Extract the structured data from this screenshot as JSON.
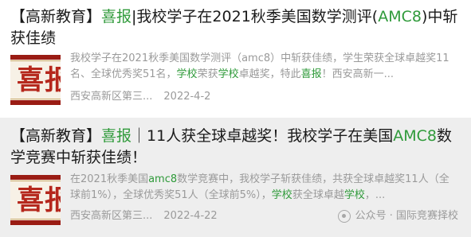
{
  "articles": [
    {
      "title_prefix": "【高新教育】",
      "title_highlight": "喜报",
      "title_rest_a": "|我校学子在2021秋季美国数学测评(",
      "title_highlight2": "AMC8",
      "title_rest_b": ")中斩获佳绩",
      "thumb_text": "喜报",
      "desc_a": "我校学子在2021秋季美国数学测评（amc8）中斩获佳绩，学生荣获全球卓越奖11名、全球优秀奖51名，",
      "desc_hl1": "学校",
      "desc_b": "荣获",
      "desc_hl2": "学校",
      "desc_c": "卓越奖，特此",
      "desc_hl3": "喜报",
      "desc_d": "！西安高新一...",
      "source": "西安高新区第三...",
      "date": "2022-4-2"
    },
    {
      "title_prefix": "【高新教育】",
      "title_highlight": "喜报",
      "title_rest_a": "｜11人获全球卓越奖！我校学子在美国",
      "title_highlight2": "AMC8",
      "title_rest_b": "数学竞赛中斩获佳绩！",
      "thumb_text": "喜报",
      "desc_a": "在2021秋季美国",
      "desc_hl1": "amc8",
      "desc_b": "数学竞赛中，我校学子斩获佳绩，共获全球卓越奖11人（全球前1%），全球优秀奖51人（全球前5%），",
      "desc_hl2": "学校",
      "desc_c": "获全球卓越",
      "desc_hl3": "学校",
      "desc_d": "，...",
      "source": "西安高新区第三...",
      "date": "2022-4-22"
    }
  ],
  "watermark": {
    "text": "公众号 · 国际竞赛择校",
    "icon": "wechat-icon"
  },
  "colors": {
    "highlight": "#2f9a3a",
    "muted": "#9a9a9a",
    "thumb_red": "#b5271c"
  }
}
